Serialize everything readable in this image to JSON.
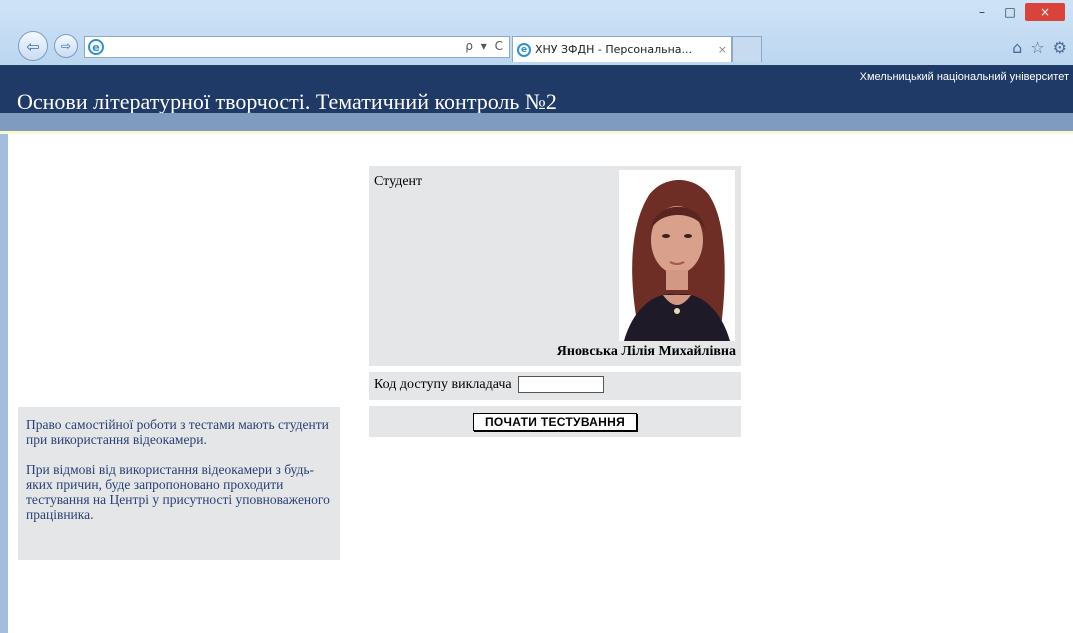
{
  "window": {
    "minimize": "–",
    "maximize": "□",
    "close": "×"
  },
  "browser": {
    "address_value": "",
    "address_tools": "ρ ▾ C",
    "tab_title": "ХНУ ЗФДН - Персональна...",
    "tab_close": "×",
    "nav_back": "⇦",
    "nav_forward": "⇨",
    "toolbar": {
      "home": "⌂",
      "favorites": "☆",
      "settings": "⚙"
    }
  },
  "header": {
    "university": "Хмельницький національний університет",
    "title": "Основи літературної творчості. Тематичний контроль №2"
  },
  "student_card": {
    "label": "Студент",
    "name": "Яновська Лілія Михайлівна",
    "code_label": "Код доступу викладача",
    "code_value": "",
    "start_button": "ПОЧАТИ ТЕСТУВАННЯ"
  },
  "info": {
    "paragraph1": "Право самостійної роботи з тестами мають студенти при використання відеокамери.",
    "paragraph2": "При відмові від використання відеокамери з будь-яких причин, буде запропоновано проходити тестування на Центрі у присутності уповноваженого працівника."
  },
  "colors": {
    "header_bg": "#1f3a66",
    "band": "#7f9bc0",
    "card_bg": "#e4e6e8",
    "info_text": "#2a3f73"
  }
}
